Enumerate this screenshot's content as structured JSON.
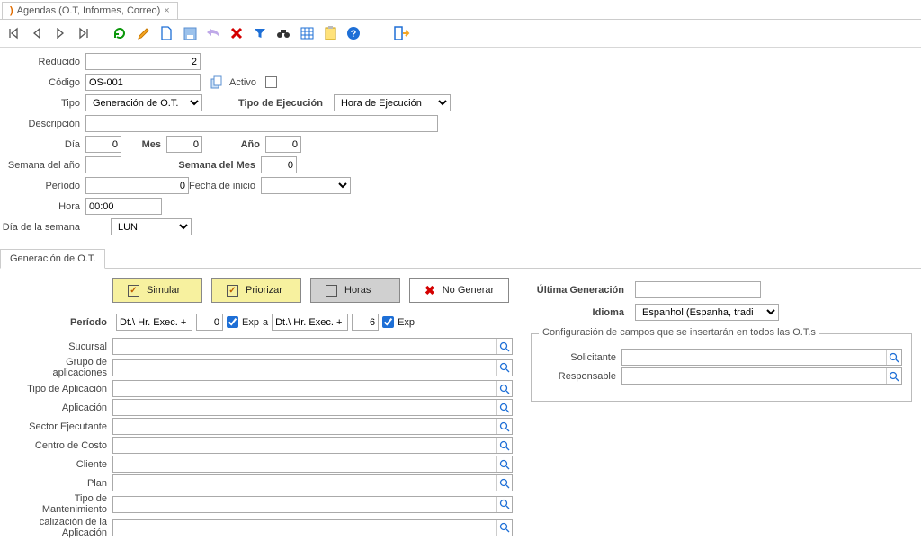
{
  "tab": {
    "title": "Agendas (O.T, Informes, Correo)"
  },
  "form": {
    "reducido_label": "Reducido",
    "reducido": "2",
    "codigo_label": "Código",
    "codigo": "OS-001",
    "activo_label": "Activo",
    "tipo_label": "Tipo",
    "tipo": "Generación de O.T.",
    "tipo_ejecucion_label": "Tipo de Ejecución",
    "tipo_ejecucion": "Hora de Ejecución",
    "descripcion_label": "Descripción",
    "descripcion": "",
    "dia_label": "Día",
    "dia": "0",
    "mes_label": "Mes",
    "mes": "0",
    "ano_label": "Año",
    "ano": "0",
    "semana_ano_label": "Semana del año",
    "semana_ano": "",
    "semana_mes_label": "Semana del Mes",
    "semana_mes": "0",
    "periodo_label": "Período",
    "periodo": "0",
    "fecha_inicio_label": "Fecha de inicio",
    "fecha_inicio": "",
    "hora_label": "Hora",
    "hora": "00:00",
    "dia_semana_label": "Día de la semana",
    "dia_semana": "LUN"
  },
  "subtab": {
    "label": "Generación de O.T."
  },
  "gen": {
    "buttons": {
      "simular": "Simular",
      "priorizar": "Priorizar",
      "horas": "Horas",
      "no_generar": "No Generar"
    },
    "periodo_label": "Período",
    "periodo_unit": "Dt.\\ Hr. Exec. +",
    "periodo_from": "0",
    "exp1": "Exp",
    "a": "a",
    "periodo_to": "6",
    "exp2": "Exp",
    "lookups": [
      "Sucursal",
      "Grupo de aplicaciones",
      "Tipo de Aplicación",
      "Aplicación",
      "Sector Ejecutante",
      "Centro de Costo",
      "Cliente",
      "Plan",
      "Tipo de Mantenimiento",
      "calización de la Aplicación"
    ],
    "ultima_gen_label": "Última Generación",
    "ultima_gen": "",
    "idioma_label": "Idioma",
    "idioma": "Espanhol (Espanha, tradi",
    "fieldset_title": "Configuración de campos que se insertarán en todos las O.T.s",
    "solicitante_label": "Solicitante",
    "responsable_label": "Responsable"
  }
}
